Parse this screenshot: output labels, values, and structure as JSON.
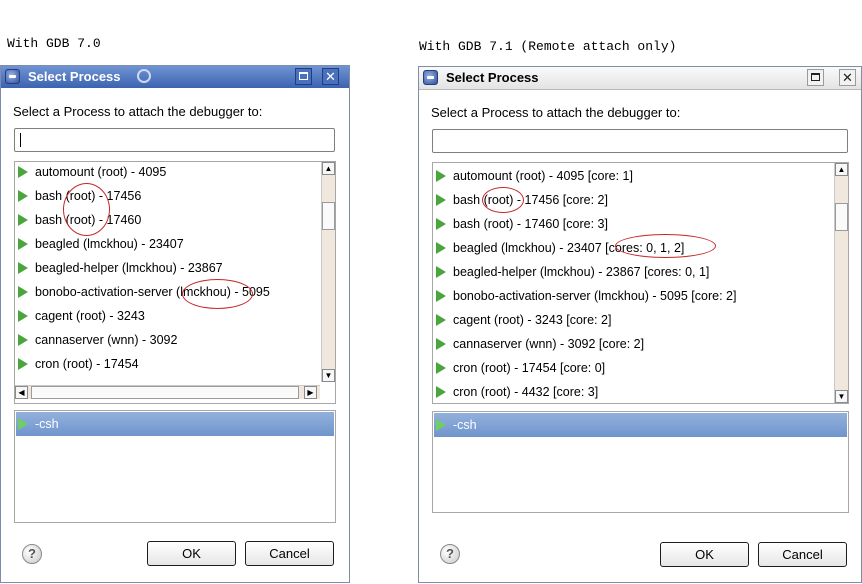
{
  "captions": {
    "left": "With GDB 7.0",
    "right": "With GDB 7.1 (Remote attach only)"
  },
  "colors": {
    "accent": "#4aa53f",
    "highlight_red": "#c62828",
    "selection": "#7d9fd3"
  },
  "icons": [
    "app-icon",
    "swirl-icon",
    "maximize-icon",
    "close-icon",
    "process-icon",
    "help-icon",
    "arrow-up-icon",
    "arrow-down-icon",
    "arrow-left-icon",
    "arrow-right-icon"
  ],
  "dialog_old": {
    "title": "Select Process",
    "prompt": "Select a Process to attach the debugger to:",
    "filter_value": "",
    "processes": [
      "automount (root) - 4095",
      "bash (root) - 17456",
      "bash (root) - 17460",
      "beagled (lmckhou) - 23407",
      "beagled-helper (lmckhou) - 23867",
      "bonobo-activation-server (lmckhou) - 5095",
      "cagent (root) - 3243",
      "cannaserver (wnn) - 3092",
      "cron (root) - 17454"
    ],
    "selected_process": "-csh",
    "ok_label": "OK",
    "cancel_label": "Cancel"
  },
  "dialog_new": {
    "title": "Select Process",
    "prompt": "Select a Process to attach the debugger to:",
    "filter_value": "",
    "processes": [
      "automount (root) - 4095 [core: 1]",
      "bash (root) - 17456 [core: 2]",
      "bash (root) - 17460 [core: 3]",
      "beagled (lmckhou) - 23407 [cores: 0, 1, 2]",
      "beagled-helper (lmckhou) - 23867 [cores: 0, 1]",
      "bonobo-activation-server (lmckhou) - 5095 [core: 2]",
      "cagent (root) - 3243 [core: 2]",
      "cannaserver (wnn) - 3092 [core: 2]",
      "cron (root) - 17454 [core: 0]",
      "cron (root) - 4432 [core: 3]"
    ],
    "selected_process": "-csh",
    "ok_label": "OK",
    "cancel_label": "Cancel"
  }
}
